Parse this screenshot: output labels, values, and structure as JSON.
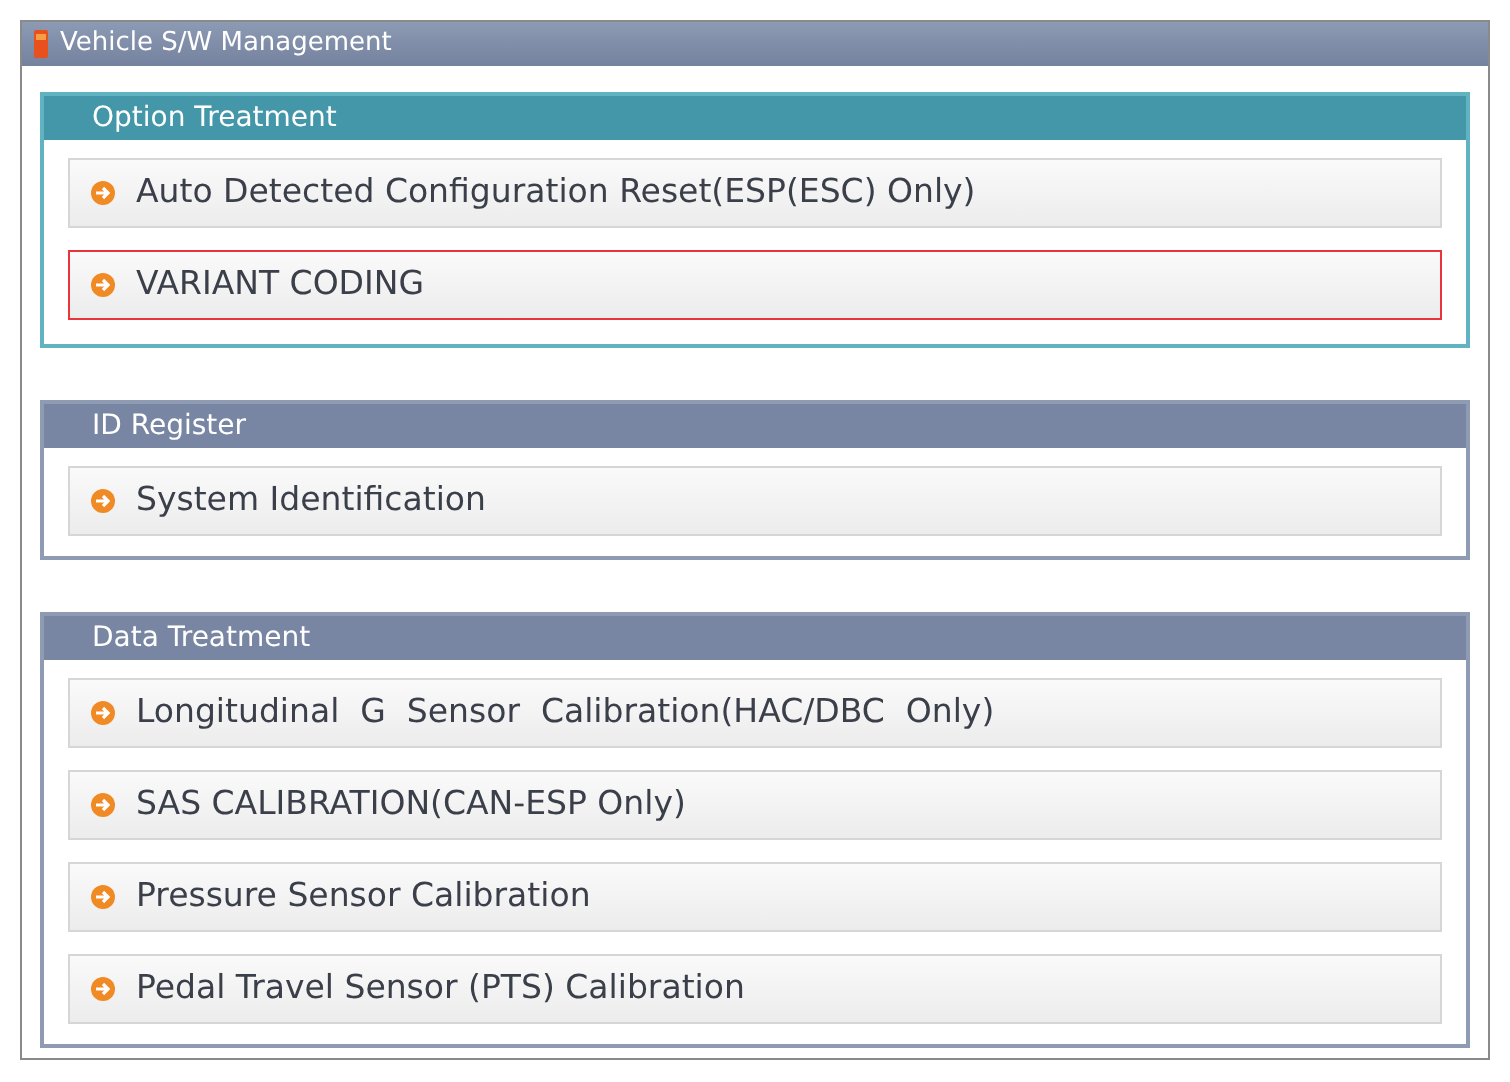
{
  "window": {
    "title": "Vehicle S/W Management"
  },
  "sections": [
    {
      "title": "Option Treatment",
      "active": true,
      "items": [
        {
          "label": "Auto Detected Configuration Reset(ESP(ESC) Only)",
          "selected": false
        },
        {
          "label": "VARIANT CODING",
          "selected": true
        }
      ]
    },
    {
      "title": "ID Register",
      "active": false,
      "items": [
        {
          "label": "System Identification",
          "selected": false
        }
      ]
    },
    {
      "title": "Data Treatment",
      "active": false,
      "items": [
        {
          "label": "Longitudinal  G  Sensor  Calibration(HAC/DBC  Only)",
          "selected": false
        },
        {
          "label": "SAS CALIBRATION(CAN-ESP Only)",
          "selected": false
        },
        {
          "label": "Pressure Sensor Calibration",
          "selected": false
        },
        {
          "label": "Pedal Travel Sensor (PTS) Calibration",
          "selected": false
        }
      ]
    }
  ]
}
